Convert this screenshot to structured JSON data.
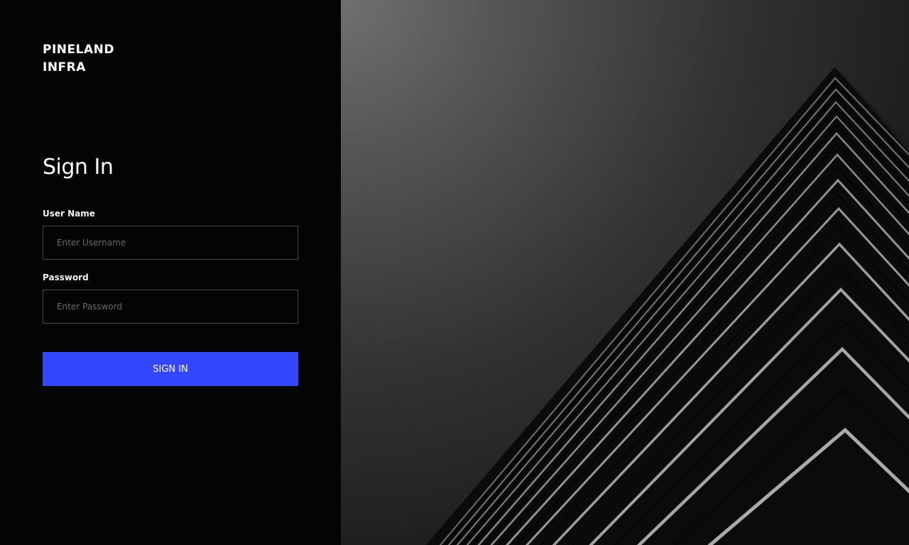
{
  "brand": {
    "line1": "PINELAND",
    "line2": "INFRA"
  },
  "form": {
    "title": "Sign In",
    "username_label": "User Name",
    "username_placeholder": "Enter Username",
    "username_value": "",
    "password_label": "Password",
    "password_placeholder": "Enter Password",
    "password_value": "",
    "submit_label": "SIGN IN"
  },
  "colors": {
    "accent": "#3447ff",
    "panel_background": "#040404",
    "input_border": "#4a4a4a"
  },
  "hero_image": {
    "subject": "building-corner-photo"
  }
}
